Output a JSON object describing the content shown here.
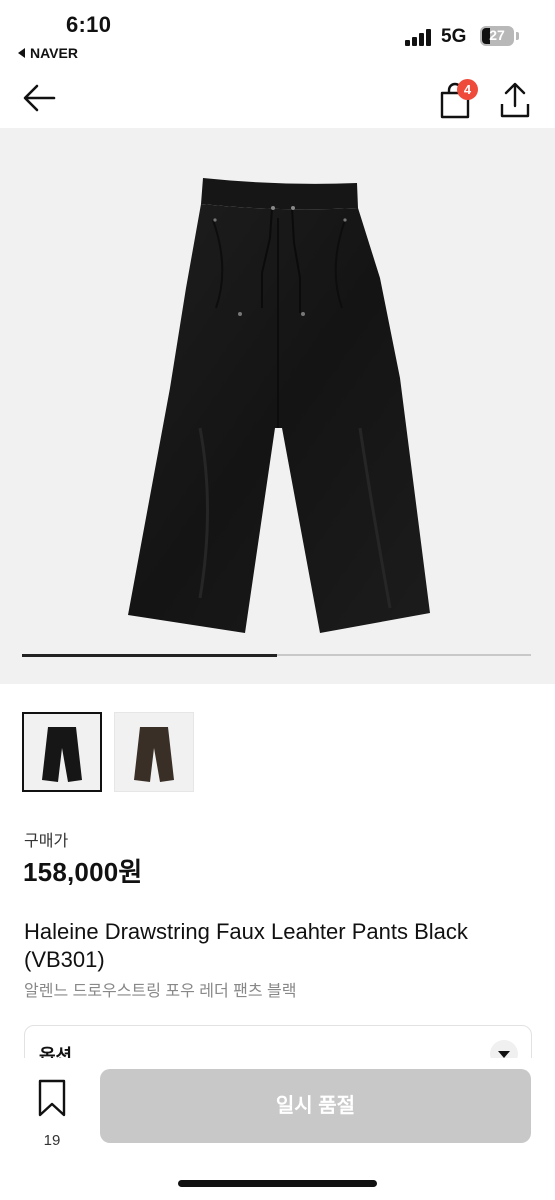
{
  "status_bar": {
    "time": "6:10",
    "back_app": "NAVER",
    "network": "5G",
    "battery": "27"
  },
  "nav": {
    "cart_badge": "4",
    "icons": [
      "back-arrow-icon",
      "shopping-bag-icon",
      "share-icon"
    ]
  },
  "gallery": {
    "progress": 0.5,
    "thumbnails": [
      {
        "name": "black-pants",
        "selected": true
      },
      {
        "name": "brown-pants",
        "selected": false
      }
    ]
  },
  "product": {
    "price_label": "구매가",
    "price": "158,000원",
    "title_en": "Haleine Drawstring Faux Leahter Pants Black (VB301)",
    "title_ko": "알렌느 드로우스트링 포우 레더 팬츠 블랙"
  },
  "option": {
    "label": "옵션"
  },
  "bottom_bar": {
    "wish_count": "19",
    "soldout_label": "일시 품절"
  },
  "colors": {
    "badge": "#ee4b3b",
    "disabled_button": "#c8c8c8",
    "hero_bg": "#f1f1f1"
  }
}
